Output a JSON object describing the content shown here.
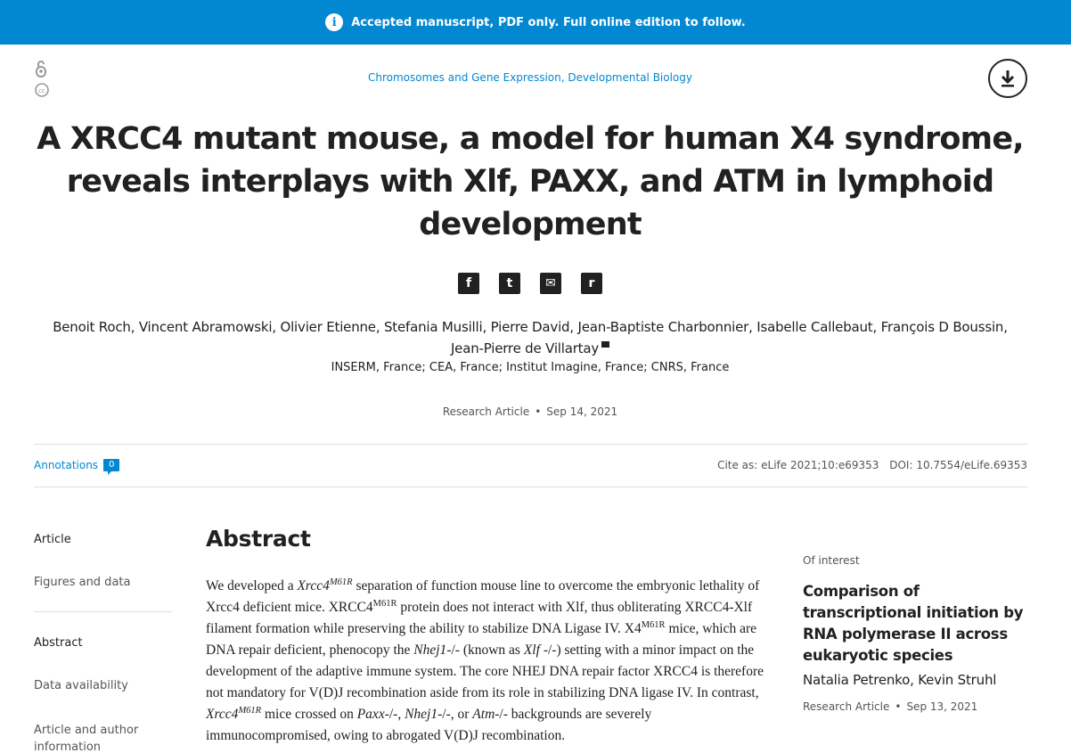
{
  "banner": {
    "text": "Accepted manuscript, PDF only. Full online edition to follow.",
    "icon": "info-icon",
    "color": "#0288d1"
  },
  "subjects": [
    "Chromosomes and Gene Expression",
    "Developmental Biology"
  ],
  "subjects_sep": ", ",
  "title": "A XRCC4 mutant mouse, a model for human X4 syndrome, reveals interplays with Xlf, PAXX, and ATM in lymphoid development",
  "share": [
    {
      "icon": "facebook-icon",
      "glyph": "f"
    },
    {
      "icon": "twitter-icon",
      "glyph": "t"
    },
    {
      "icon": "email-icon",
      "glyph": "✉"
    },
    {
      "icon": "reddit-icon",
      "glyph": "r"
    }
  ],
  "authors": [
    "Benoit Roch",
    "Vincent Abramowski",
    "Olivier Etienne",
    "Stefania Musilli",
    "Pierre David",
    "Jean-Baptiste Charbonnier",
    "Isabelle Callebaut",
    "François D Boussin",
    "Jean-Pierre de Villartay"
  ],
  "affiliations": "INSERM, France; CEA, France; Institut Imagine, France; CNRS, France",
  "meta": {
    "type": "Research Article",
    "date": "Sep 14, 2021"
  },
  "annotations": {
    "label": "Annotations",
    "count": "0"
  },
  "cite": {
    "cite_as": "Cite as: eLife 2021;10:e69353",
    "doi": "DOI: 10.7554/eLife.69353"
  },
  "nav": {
    "top": [
      "Article",
      "Figures and data"
    ],
    "sections": [
      "Abstract",
      "Data availability",
      "Article and author information"
    ]
  },
  "abstract": {
    "heading": "Abstract"
  },
  "interest": {
    "label": "Of interest",
    "title": "Comparison of transcriptional initiation by RNA polymerase II across eukaryotic species",
    "authors": "Natalia Petrenko, Kevin Struhl",
    "type": "Research Article",
    "date": "Sep 13, 2021"
  }
}
